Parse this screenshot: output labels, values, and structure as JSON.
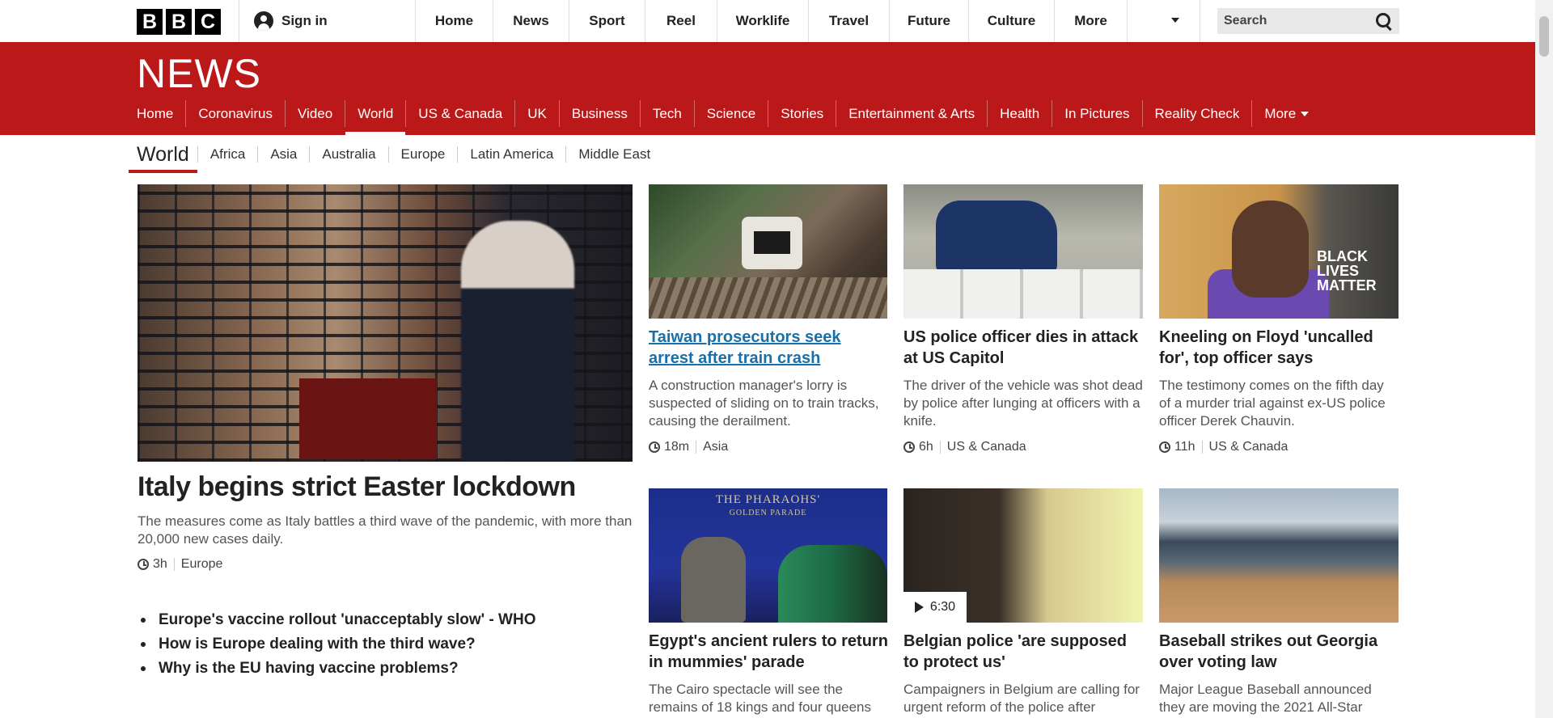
{
  "topbar": {
    "logo_letters": [
      "B",
      "B",
      "C"
    ],
    "signin_label": "Sign in",
    "nav": [
      "Home",
      "News",
      "Sport",
      "Reel",
      "Worklife",
      "Travel",
      "Future",
      "Culture",
      "More"
    ],
    "search_placeholder": "Search"
  },
  "news": {
    "title": "NEWS",
    "nav": [
      "Home",
      "Coronavirus",
      "Video",
      "World",
      "US & Canada",
      "UK",
      "Business",
      "Tech",
      "Science",
      "Stories",
      "Entertainment & Arts",
      "Health",
      "In Pictures",
      "Reality Check"
    ],
    "active": "World",
    "more_label": "More"
  },
  "subnav": {
    "section": "World",
    "items": [
      "Africa",
      "Asia",
      "Australia",
      "Europe",
      "Latin America",
      "Middle East"
    ]
  },
  "lead": {
    "headline": "Italy begins strict Easter lockdown",
    "summary": "The measures come as Italy battles a third wave of the pandemic, with more than 20,000 new cases daily.",
    "time": "3h",
    "section": "Europe",
    "related": [
      "Europe's vaccine rollout 'unacceptably slow' - WHO",
      "How is Europe dealing with the third wave?",
      "Why is the EU having vaccine problems?"
    ]
  },
  "cards": [
    {
      "headline": "Taiwan prosecutors seek arrest after train crash",
      "summary": "A construction manager's lorry is suspected of sliding on to train tracks, causing the derailment.",
      "time": "18m",
      "section": "Asia"
    },
    {
      "headline": "US police officer dies in attack at US Capitol",
      "summary": "The driver of the vehicle was shot dead by police after lunging at officers with a knife.",
      "time": "6h",
      "section": "US & Canada"
    },
    {
      "headline": "Kneeling on Floyd 'uncalled for', top officer says",
      "summary": "The testimony comes on the fifth day of a murder trial against ex-US police officer Derek Chauvin.",
      "time": "11h",
      "section": "US & Canada",
      "image_text": [
        "BLACK",
        "LIVES",
        "MATTER"
      ]
    },
    {
      "headline": "Egypt's ancient rulers to return in mummies' parade",
      "summary": "The Cairo spectacle will see the remains of 18 kings and four queens",
      "image_text": [
        "THE PHARAOHS'",
        "GOLDEN PARADE"
      ]
    },
    {
      "headline": "Belgian police 'are supposed to protect us'",
      "summary": "Campaigners in Belgium are calling for urgent reform of the police after",
      "video_duration": "6:30"
    },
    {
      "headline": "Baseball strikes out Georgia over voting law",
      "summary": "Major League Baseball announced they are moving the 2021 All-Star"
    }
  ],
  "colors": {
    "brand_red": "#bb1919",
    "link_blue": "#1b6fa8"
  }
}
